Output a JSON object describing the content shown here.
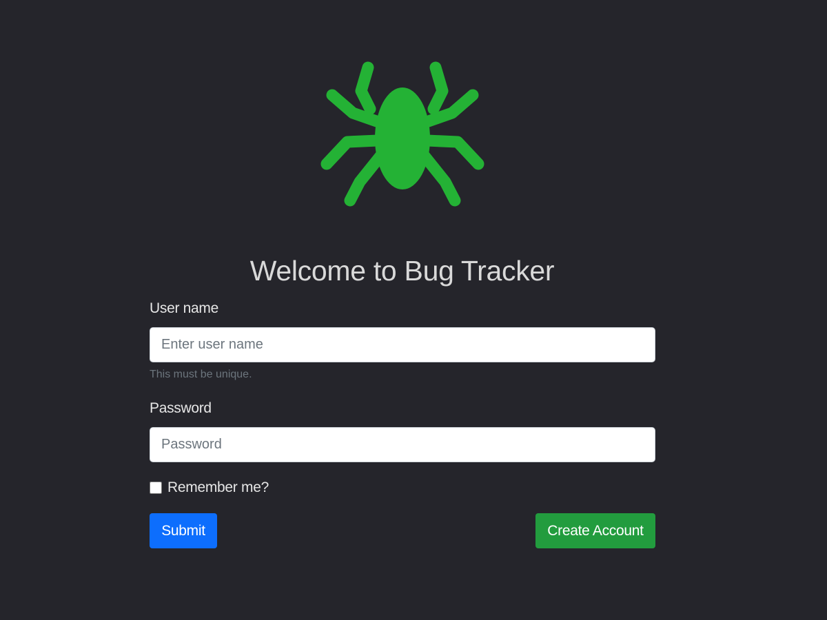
{
  "colors": {
    "background": "#25252b",
    "logo": "#24b235",
    "submit_button": "#0d6efd",
    "create_button": "#229c3e"
  },
  "logo": {
    "icon": "spider-icon"
  },
  "title": "Welcome to Bug Tracker",
  "form": {
    "username": {
      "label": "User name",
      "placeholder": "Enter user name",
      "value": "",
      "help": "This must be unique."
    },
    "password": {
      "label": "Password",
      "placeholder": "Password",
      "value": ""
    },
    "remember": {
      "label": "Remember me?",
      "checked": false
    },
    "submit_label": "Submit",
    "create_label": "Create Account"
  }
}
